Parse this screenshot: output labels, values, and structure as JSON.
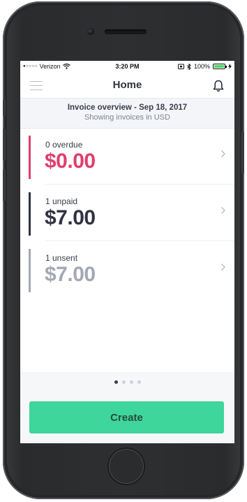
{
  "status_bar": {
    "carrier_dots": "●○○○○",
    "carrier": "Verizon",
    "time": "3:20 PM",
    "battery": "100%",
    "battery_level": 1.0
  },
  "nav": {
    "title": "Home",
    "menu_icon": "hamburger-menu-icon",
    "bell_icon": "bell-icon"
  },
  "overview": {
    "title": "Invoice overview - Sep 18, 2017",
    "subtitle": "Showing invoices in USD"
  },
  "cards": [
    {
      "label": "0 overdue",
      "amount": "$0.00",
      "color": "#e03e6c",
      "bar_color": "#e03e6c"
    },
    {
      "label": "1 unpaid",
      "amount": "$7.00",
      "color": "#2f3240",
      "bar_color": "#2f3240"
    },
    {
      "label": "1 unsent",
      "amount": "$7.00",
      "color": "#a3a8b4",
      "bar_color": "#a3a8b4"
    }
  ],
  "pager": {
    "pages": 4,
    "active_index": 0
  },
  "footer": {
    "create_label": "Create",
    "accent": "#3ed69a"
  }
}
